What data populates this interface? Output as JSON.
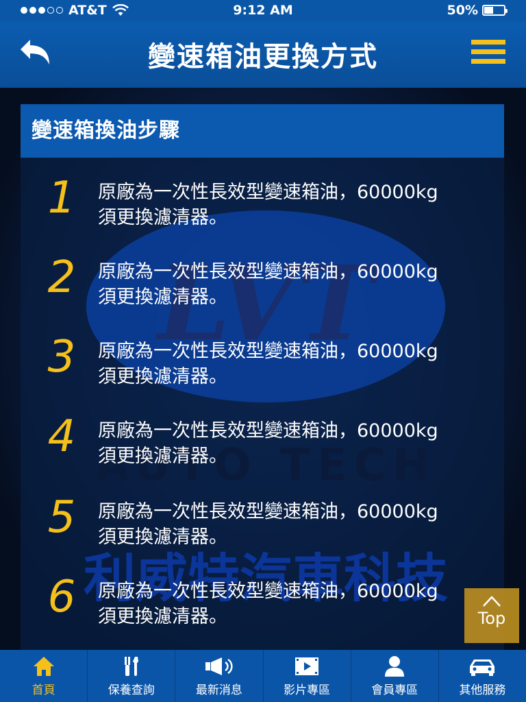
{
  "status_bar": {
    "carrier": "AT&T",
    "time": "9:12 AM",
    "battery": "50%",
    "battery_level": 0.5
  },
  "nav": {
    "title": "變速箱油更換方式",
    "back_icon": "back-arrow-icon",
    "menu_icon": "hamburger-menu-icon"
  },
  "panel": {
    "header": "變速箱換油步驟",
    "steps": [
      {
        "number": "1",
        "line1": "原廠為一次性長效型變速箱油，60000kg",
        "line2": "須更換濾清器。"
      },
      {
        "number": "2",
        "line1": "原廠為一次性長效型變速箱油，60000kg",
        "line2": "須更換濾清器。"
      },
      {
        "number": "3",
        "line1": "原廠為一次性長效型變速箱油，60000kg",
        "line2": "須更換濾清器。"
      },
      {
        "number": "4",
        "line1": "原廠為一次性長效型變速箱油，60000kg",
        "line2": "須更換濾清器。"
      },
      {
        "number": "5",
        "line1": "原廠為一次性長效型變速箱油，60000kg",
        "line2": "須更換濾清器。"
      },
      {
        "number": "6",
        "line1": "原廠為一次性長效型變速箱油，60000kg",
        "line2": "須更換濾清器。"
      }
    ],
    "watermark": {
      "logo_text": "LVT",
      "arc_text": "AUTO TECH",
      "company_text": "利威特汽車科技"
    }
  },
  "top_button": {
    "label": "Top",
    "icon": "chevron-up-icon"
  },
  "tabs": [
    {
      "label": "首頁",
      "icon": "home-icon",
      "active": true
    },
    {
      "label": "保養查詢",
      "icon": "tools-icon",
      "active": false
    },
    {
      "label": "最新消息",
      "icon": "megaphone-icon",
      "active": false
    },
    {
      "label": "影片專區",
      "icon": "video-icon",
      "active": false
    },
    {
      "label": "會員專區",
      "icon": "user-icon",
      "active": false
    },
    {
      "label": "其他服務",
      "icon": "car-icon",
      "active": false
    }
  ],
  "colors": {
    "brand_blue": "#0a55a8",
    "accent_yellow": "#f5c01a",
    "background_dark": "#05101f"
  }
}
